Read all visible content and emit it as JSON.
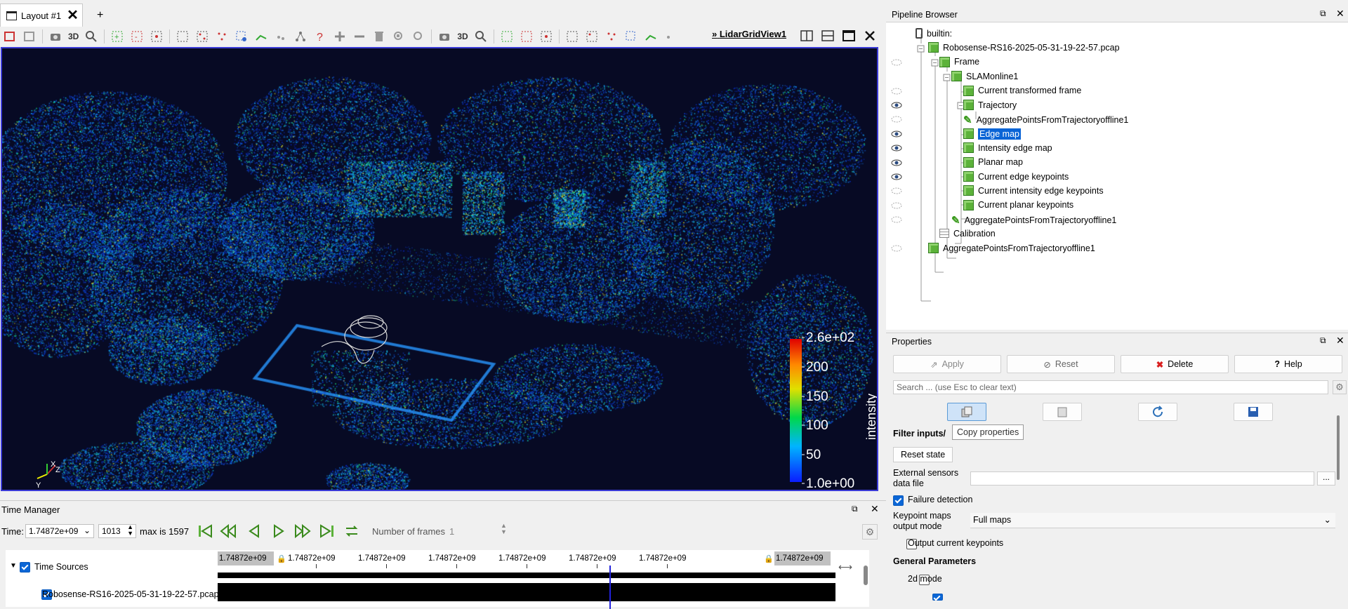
{
  "layout_tab": {
    "title": "Layout #1",
    "close_glyph": "✕",
    "add_glyph": "+"
  },
  "toolbar": {
    "left_3d_label": "3D",
    "right_3d_label": "3D",
    "view_name": "LidarGridView1",
    "view_prefix": "»"
  },
  "colorbar": {
    "title": "intensity",
    "ticks": [
      "2.6e+02",
      "200",
      "150",
      "100",
      "50",
      "1.0e+00"
    ]
  },
  "axes_gizmo": {
    "x": "X",
    "y": "Y",
    "z": "Z"
  },
  "time_manager": {
    "title": "Time Manager",
    "time_label": "Time:",
    "time_value": "1.74872e+09",
    "frame_index": "1013",
    "max_text": "max is 1597",
    "num_frames_label": "Number of frames",
    "num_frames_value": "1",
    "ruler_ticks": [
      "1.74872e+09",
      "1.74872e+09",
      "1.74872e+09",
      "1.74872e+09",
      "1.74872e+09",
      "1.74872e+09",
      "1.74872e+09"
    ],
    "ruler_start": "1.74872e+09",
    "ruler_end": "1.74872e+09",
    "tree": [
      {
        "label": "Time Sources",
        "checked": true
      },
      {
        "label": "Robosense-RS16-2025-05-31-19-22-57.pcap",
        "checked": true
      }
    ],
    "current_position_fraction": 0.634
  },
  "pipeline_browser": {
    "title": "Pipeline Browser",
    "nodes": [
      {
        "label": "builtin:",
        "eye": "none"
      },
      {
        "label": "Robosense-RS16-2025-05-31-19-22-57.pcap",
        "eye": "none"
      },
      {
        "label": "Frame",
        "eye": "hidden"
      },
      {
        "label": "SLAMonline1",
        "eye": "none"
      },
      {
        "label": "Current transformed frame",
        "eye": "hidden"
      },
      {
        "label": "Trajectory",
        "eye": "visible"
      },
      {
        "label": "AggregatePointsFromTrajectoryoffline1",
        "eye": "hidden"
      },
      {
        "label": "Edge map",
        "eye": "visible",
        "selected": true
      },
      {
        "label": "Intensity edge map",
        "eye": "visible"
      },
      {
        "label": "Planar map",
        "eye": "visible"
      },
      {
        "label": "Current edge keypoints",
        "eye": "visible"
      },
      {
        "label": "Current intensity edge keypoints",
        "eye": "hidden"
      },
      {
        "label": "Current planar keypoints",
        "eye": "hidden"
      },
      {
        "label": "AggregatePointsFromTrajectoryoffline1",
        "eye": "hidden"
      },
      {
        "label": "Calibration",
        "eye": "none"
      },
      {
        "label": "AggregatePointsFromTrajectoryoffline1",
        "eye": "hidden"
      }
    ]
  },
  "properties": {
    "title": "Properties",
    "apply_label": "Apply",
    "reset_label": "Reset",
    "delete_label": "Delete",
    "help_label": "Help",
    "search_placeholder": "Search ... (use Esc to clear text)",
    "tooltip": "Copy properties",
    "filter_inputs_label": "Filter inputs/",
    "reset_state_label": "Reset state",
    "external_sensors_label": "External sensors data file",
    "external_sensors_value": "",
    "browse_label": "...",
    "failure_detection_label": "Failure detection",
    "failure_detection_checked": true,
    "keypoint_maps_label": "Keypoint maps output mode",
    "keypoint_maps_value": "Full maps",
    "output_keypoints_label": "Output current keypoints",
    "output_keypoints_checked": false,
    "general_params_label": "General Parameters",
    "mode_2d_label": "2d mode",
    "mode_2d_checked": false
  },
  "colors": {
    "accent": "#0a64d6",
    "view_background": "#070a24",
    "view_border": "#3b3bd6",
    "delete_red": "#d92020",
    "cube_green": "#5cb23a"
  }
}
